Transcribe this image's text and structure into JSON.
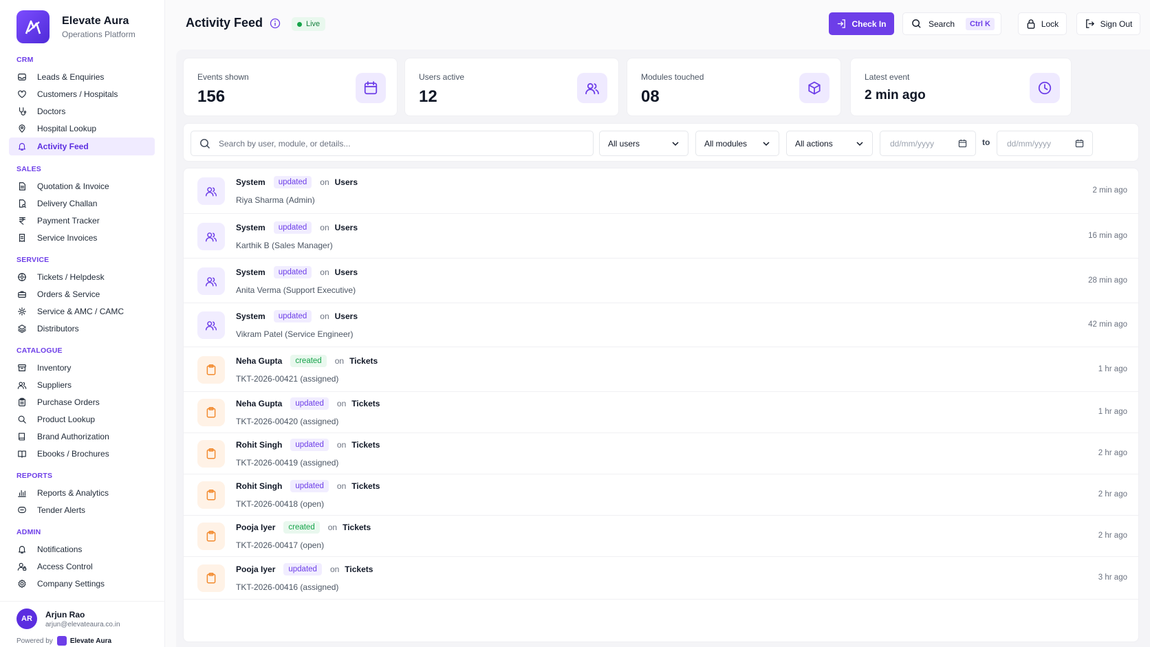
{
  "brand": {
    "name": "Elevate Aura",
    "subtitle": "Operations Platform"
  },
  "sidebar": {
    "sections": [
      {
        "title": "CRM",
        "items": [
          {
            "label": "Leads & Enquiries",
            "icon": "inbox-icon"
          },
          {
            "label": "Customers / Hospitals",
            "icon": "heart-icon"
          },
          {
            "label": "Doctors",
            "icon": "stethoscope-icon"
          },
          {
            "label": "Hospital Lookup",
            "icon": "map-pin-icon"
          },
          {
            "label": "Activity Feed",
            "icon": "bell-icon",
            "active": true
          }
        ]
      },
      {
        "title": "SALES",
        "items": [
          {
            "label": "Quotation & Invoice",
            "icon": "file-text-icon"
          },
          {
            "label": "Delivery Challan",
            "icon": "file-search-icon"
          },
          {
            "label": "Payment Tracker",
            "icon": "rupee-icon"
          },
          {
            "label": "Service Invoices",
            "icon": "receipt-icon"
          }
        ]
      },
      {
        "title": "SERVICE",
        "items": [
          {
            "label": "Tickets / Helpdesk",
            "icon": "ticket-icon"
          },
          {
            "label": "Orders & Service",
            "icon": "briefcase-icon"
          },
          {
            "label": "Service & AMC / CAMC",
            "icon": "settings-icon"
          },
          {
            "label": "Distributors",
            "icon": "layers-icon"
          }
        ]
      },
      {
        "title": "CATALOGUE",
        "items": [
          {
            "label": "Inventory",
            "icon": "archive-icon"
          },
          {
            "label": "Suppliers",
            "icon": "users-icon"
          },
          {
            "label": "Purchase Orders",
            "icon": "clipboard-icon"
          },
          {
            "label": "Product Lookup",
            "icon": "search-icon"
          },
          {
            "label": "Brand Authorization",
            "icon": "book-icon"
          },
          {
            "label": "Ebooks / Brochures",
            "icon": "book-open-icon"
          }
        ]
      },
      {
        "title": "REPORTS",
        "items": [
          {
            "label": "Reports & Analytics",
            "icon": "bar-chart-icon"
          },
          {
            "label": "Tender Alerts",
            "icon": "message-icon"
          }
        ]
      },
      {
        "title": "ADMIN",
        "items": [
          {
            "label": "Notifications",
            "icon": "bell-icon"
          },
          {
            "label": "Access Control",
            "icon": "user-lock-icon"
          },
          {
            "label": "Company Settings",
            "icon": "gear-icon"
          }
        ]
      }
    ]
  },
  "user": {
    "initials": "AR",
    "name": "Arjun Rao",
    "email": "arjun@elevateaura.co.in"
  },
  "powered": {
    "prefix": "Powered by",
    "name": "Elevate Aura"
  },
  "header": {
    "title": "Activity Feed",
    "live_label": "Live",
    "checkin_label": "Check In",
    "search_label": "Search",
    "search_shortcut": "Ctrl K",
    "lock_label": "Lock",
    "signout_label": "Sign Out"
  },
  "stats": [
    {
      "label": "Events shown",
      "value": "156",
      "icon": "calendar-icon"
    },
    {
      "label": "Users active",
      "value": "12",
      "icon": "users-icon"
    },
    {
      "label": "Modules touched",
      "value": "08",
      "icon": "box-icon"
    },
    {
      "label": "Latest event",
      "value": "2 min ago",
      "icon": "clock-icon"
    }
  ],
  "filters": {
    "search_placeholder": "Search by user, module, or details...",
    "users": "All users",
    "modules": "All modules",
    "actions": "All actions",
    "date_from_placeholder": "dd/mm/yyyy",
    "to_label": "to",
    "date_to_placeholder": "dd/mm/yyyy"
  },
  "feed": [
    {
      "actor": "System",
      "action": "updated",
      "on": "on",
      "module": "Users",
      "detail": "Riya Sharma (Admin)",
      "time": "2 min ago",
      "kind": "users"
    },
    {
      "actor": "System",
      "action": "updated",
      "on": "on",
      "module": "Users",
      "detail": "Karthik B (Sales Manager)",
      "time": "16 min ago",
      "kind": "users"
    },
    {
      "actor": "System",
      "action": "updated",
      "on": "on",
      "module": "Users",
      "detail": "Anita Verma (Support Executive)",
      "time": "28 min ago",
      "kind": "users"
    },
    {
      "actor": "System",
      "action": "updated",
      "on": "on",
      "module": "Users",
      "detail": "Vikram Patel (Service Engineer)",
      "time": "42 min ago",
      "kind": "users"
    },
    {
      "actor": "Neha Gupta",
      "action": "created",
      "on": "on",
      "module": "Tickets",
      "detail": "TKT-2026-00421 (assigned)",
      "time": "1 hr ago",
      "kind": "tickets"
    },
    {
      "actor": "Neha Gupta",
      "action": "updated",
      "on": "on",
      "module": "Tickets",
      "detail": "TKT-2026-00420 (assigned)",
      "time": "1 hr ago",
      "kind": "tickets"
    },
    {
      "actor": "Rohit Singh",
      "action": "updated",
      "on": "on",
      "module": "Tickets",
      "detail": "TKT-2026-00419 (assigned)",
      "time": "2 hr ago",
      "kind": "tickets"
    },
    {
      "actor": "Rohit Singh",
      "action": "updated",
      "on": "on",
      "module": "Tickets",
      "detail": "TKT-2026-00418 (open)",
      "time": "2 hr ago",
      "kind": "tickets"
    },
    {
      "actor": "Pooja Iyer",
      "action": "created",
      "on": "on",
      "module": "Tickets",
      "detail": "TKT-2026-00417 (open)",
      "time": "2 hr ago",
      "kind": "tickets"
    },
    {
      "actor": "Pooja Iyer",
      "action": "updated",
      "on": "on",
      "module": "Tickets",
      "detail": "TKT-2026-00416 (assigned)",
      "time": "3 hr ago",
      "kind": "tickets"
    }
  ],
  "colors": {
    "accent": "#6d3ee8",
    "accent_soft": "#efeaff",
    "success": "#16a34a",
    "ticket_orange": "#f28a2e"
  }
}
